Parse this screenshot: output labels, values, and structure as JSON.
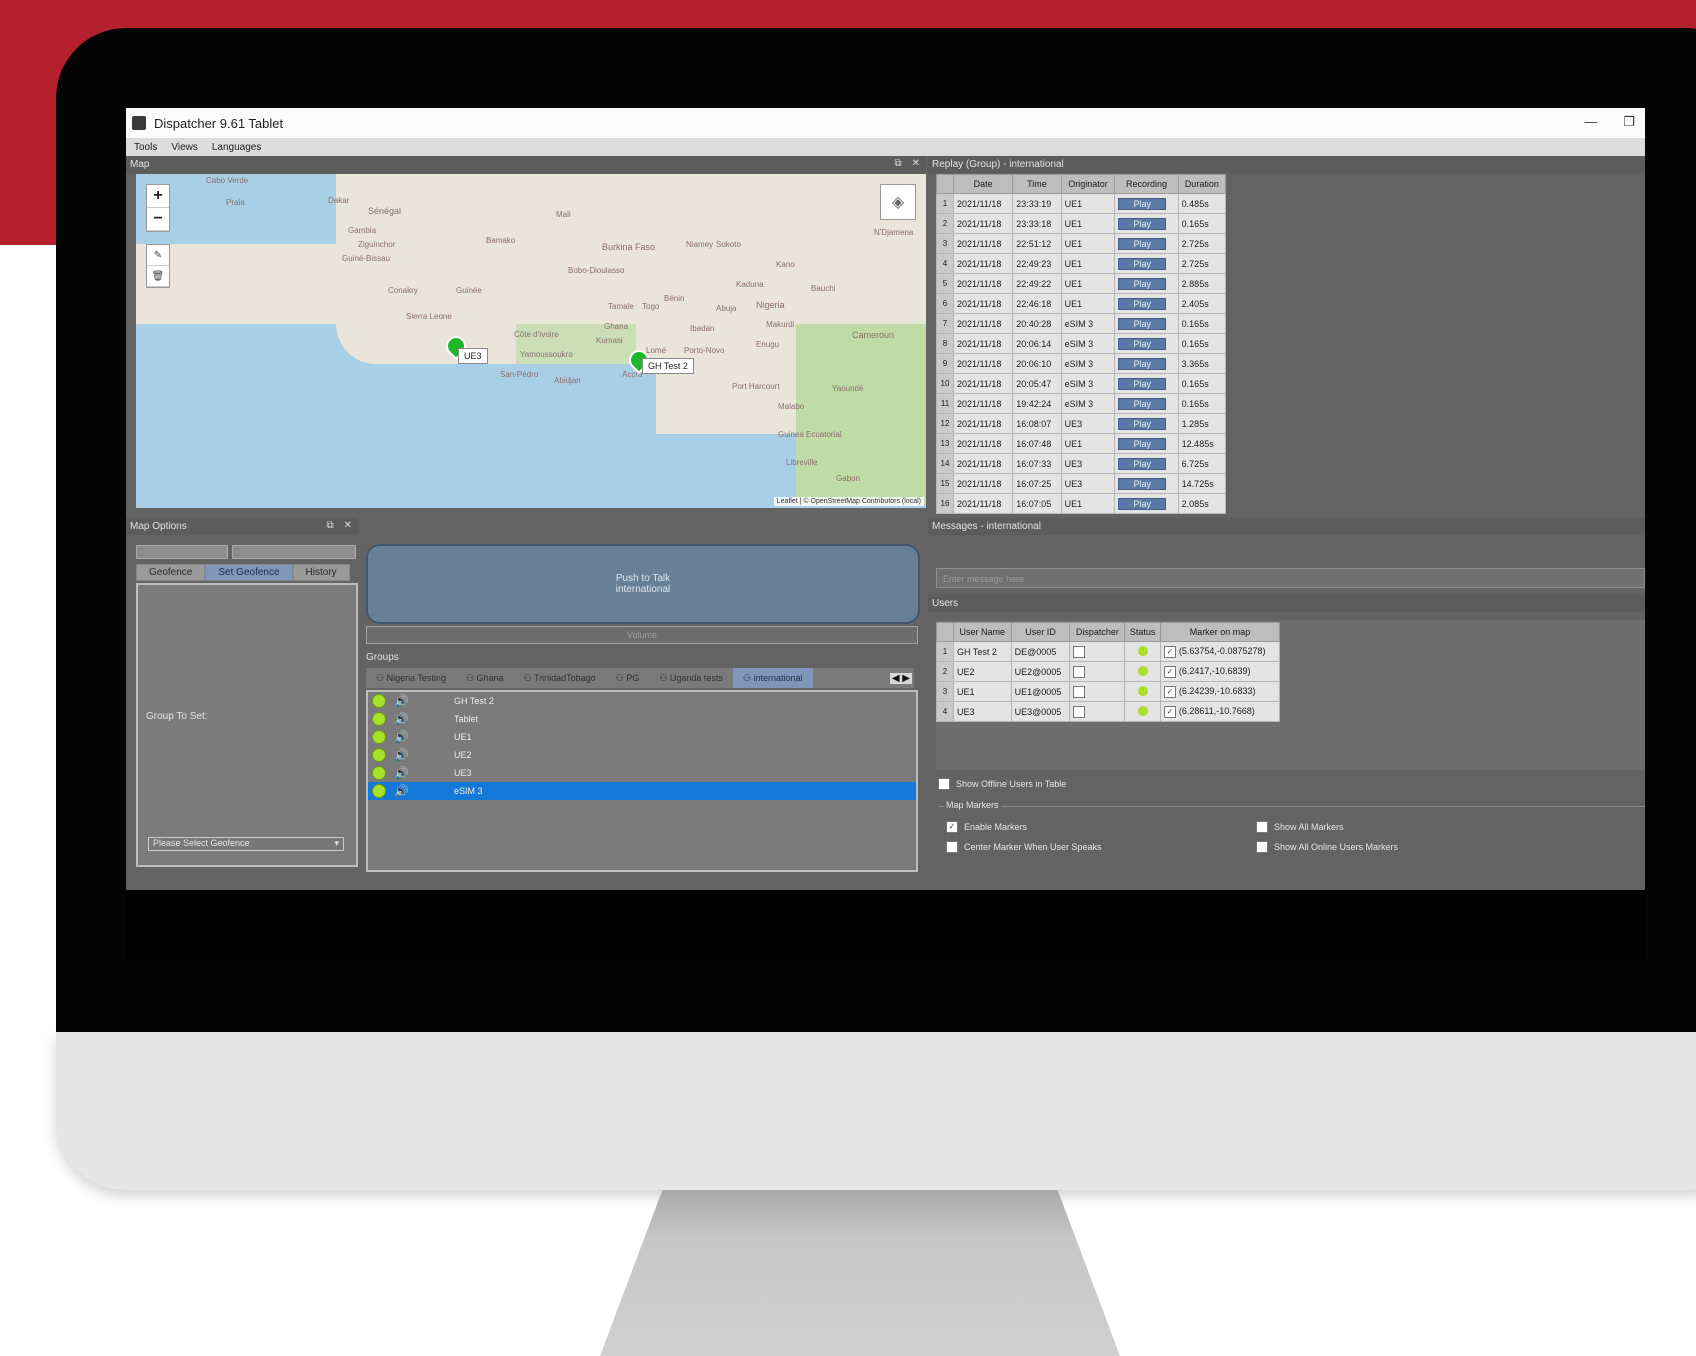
{
  "window": {
    "title": "Dispatcher 9.61 Tablet",
    "minimize": "—",
    "restore": "❐"
  },
  "menu": [
    "Tools",
    "Views",
    "Languages"
  ],
  "map_panel": {
    "title": "Map",
    "places": [
      "Cabo Verde",
      "Praia",
      "Dakar",
      "Sénégal",
      "Gambia",
      "Ziguinchor",
      "Guiné-Bissau",
      "Conakry",
      "Guinée",
      "Bamako",
      "Mali",
      "Burkina Faso",
      "Bobo-Dioulasso",
      "Niamey",
      "Sokoto",
      "Kano",
      "Kaduna",
      "Bauchi",
      "Abuja",
      "Nigeria",
      "Makurdi",
      "Tamale",
      "Ghana",
      "Togo",
      "Bénin",
      "Ibadan",
      "Sierra Leone",
      "Côte d'Ivoire",
      "Yamoussoukro",
      "Kumasi",
      "Lomé",
      "Porto-Novo",
      "Enugu",
      "Abidjan",
      "San-Pédro",
      "Accra",
      "Port Harcourt",
      "Yaoundé",
      "Malabo",
      "Cameroun",
      "Guinea Ecuatorial",
      "Libreville",
      "Gabon",
      "N'Djamena"
    ],
    "markers": [
      {
        "label": "UE3"
      },
      {
        "label": "GH Test 2"
      }
    ],
    "attribution": "Leaflet | © OpenStreetMap Contributors (local)"
  },
  "replay": {
    "title": "Replay (Group) - international",
    "columns": [
      "Date",
      "Time",
      "Originator",
      "Recording",
      "Duration"
    ],
    "play_label": "Play",
    "rows": [
      [
        "1",
        "2021/11/18",
        "23:33:19",
        "UE1",
        "0.485s"
      ],
      [
        "2",
        "2021/11/18",
        "23:33:18",
        "UE1",
        "0.165s"
      ],
      [
        "3",
        "2021/11/18",
        "22:51:12",
        "UE1",
        "2.725s"
      ],
      [
        "4",
        "2021/11/18",
        "22:49:23",
        "UE1",
        "2.725s"
      ],
      [
        "5",
        "2021/11/18",
        "22:49:22",
        "UE1",
        "2.885s"
      ],
      [
        "6",
        "2021/11/18",
        "22:46:18",
        "UE1",
        "2.405s"
      ],
      [
        "7",
        "2021/11/18",
        "20:40:28",
        "eSIM 3",
        "0.165s"
      ],
      [
        "8",
        "2021/11/18",
        "20:06:14",
        "eSIM 3",
        "0.165s"
      ],
      [
        "9",
        "2021/11/18",
        "20:06:10",
        "eSIM 3",
        "3.365s"
      ],
      [
        "10",
        "2021/11/18",
        "20:05:47",
        "eSIM 3",
        "0.165s"
      ],
      [
        "11",
        "2021/11/18",
        "19:42:24",
        "eSIM 3",
        "0.165s"
      ],
      [
        "12",
        "2021/11/18",
        "16:08:07",
        "UE3",
        "1.285s"
      ],
      [
        "13",
        "2021/11/18",
        "16:07:48",
        "UE1",
        "12.485s"
      ],
      [
        "14",
        "2021/11/18",
        "16:07:33",
        "UE3",
        "6.725s"
      ],
      [
        "15",
        "2021/11/18",
        "16:07:25",
        "UE3",
        "14.725s"
      ],
      [
        "16",
        "2021/11/18",
        "16:07:05",
        "UE1",
        "2.085s"
      ]
    ]
  },
  "map_options": {
    "title": "Map Options",
    "tabs": [
      "Geofence",
      "Set Geofence",
      "History"
    ],
    "group_to_set": "Group To Set:",
    "select_placeholder": "Please Select Geofence"
  },
  "ptt": {
    "line1": "Push to Talk",
    "line2": "international",
    "volume": "Volume"
  },
  "groups": {
    "label": "Groups",
    "tabs": [
      "Nigeria Testing",
      "Ghana",
      "TrinidadTobago",
      "PG",
      "Uganda tests",
      "international"
    ],
    "members": [
      "GH Test 2",
      "Tablet",
      "UE1",
      "UE2",
      "UE3",
      "eSIM 3"
    ]
  },
  "messages": {
    "title": "Messages - international",
    "placeholder": "Enter message here"
  },
  "users": {
    "title": "Users",
    "columns": [
      "User Name",
      "User ID",
      "Dispatcher",
      "Status",
      "Marker on map"
    ],
    "rows": [
      [
        "1",
        "GH Test 2",
        "DE@0005",
        "(5.63754,-0.0875278)"
      ],
      [
        "2",
        "UE2",
        "UE2@0005",
        "(6.2417,-10.6839)"
      ],
      [
        "3",
        "UE1",
        "UE1@0005",
        "(6.24239,-10.6833)"
      ],
      [
        "4",
        "UE3",
        "UE3@0005",
        "(6.28611,-10.7668)"
      ]
    ],
    "show_offline": "Show Offline Users in Table",
    "map_markers": "Map Markers",
    "enable_markers": "Enable Markers",
    "center_marker": "Center Marker When User Speaks",
    "show_all": "Show All Markers",
    "show_all_online": "Show All Online Users Markers"
  },
  "colors": {
    "brand_red": "#b5202e",
    "selection_blue": "#1478d8",
    "status_green": "#a9e02a",
    "tab_active": "#7e97b8"
  }
}
